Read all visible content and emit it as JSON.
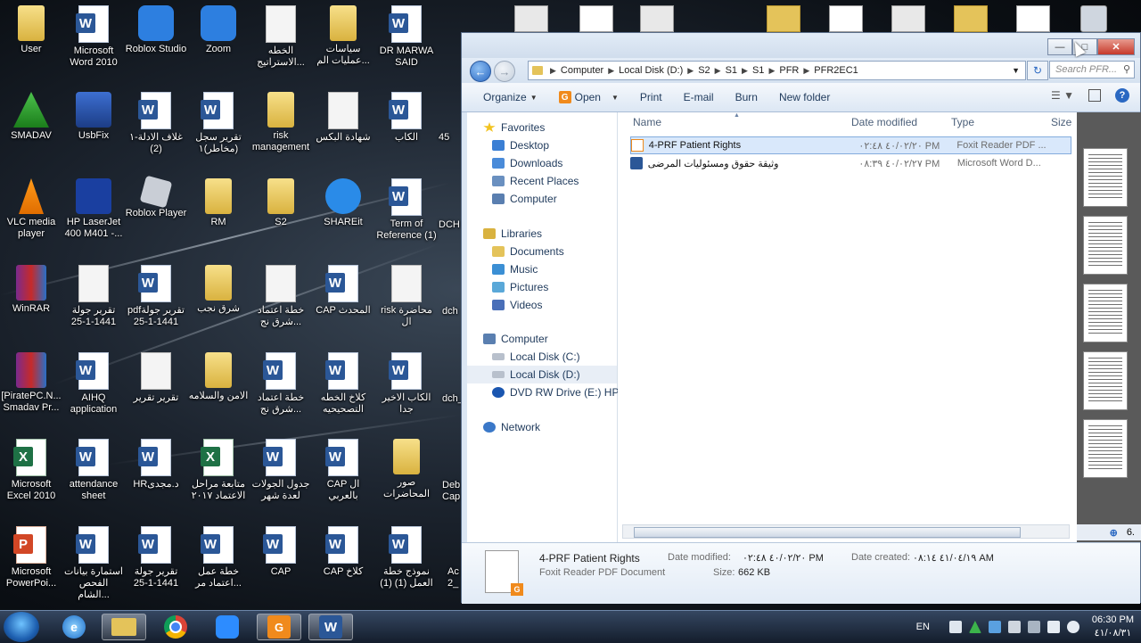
{
  "desktop": {
    "icons": [
      {
        "label": "User",
        "kind": "folder"
      },
      {
        "label": "Microsoft Word 2010",
        "kind": "word"
      },
      {
        "label": "Roblox Studio",
        "kind": "blue"
      },
      {
        "label": "Zoom",
        "kind": "blue"
      },
      {
        "label": "الخطه الاستراتيج...",
        "kind": "doc"
      },
      {
        "label": "سياسات عمليات الم...",
        "kind": "folder"
      },
      {
        "label": "DR MARWA SAID",
        "kind": "word"
      },
      {
        "label": "SMADAV",
        "kind": "green"
      },
      {
        "label": "UsbFix",
        "kind": "usb"
      },
      {
        "label": "غلاف الادلة-١ (2)",
        "kind": "word"
      },
      {
        "label": "تقرير سجل (مخاطر)١",
        "kind": "word"
      },
      {
        "label": "risk management",
        "kind": "folder"
      },
      {
        "label": "شهادة البكس",
        "kind": "doc"
      },
      {
        "label": "الكاب",
        "kind": "word"
      },
      {
        "label": "VLC media player",
        "kind": "cone"
      },
      {
        "label": "HP LaserJet 400 M401 -...",
        "kind": "hp"
      },
      {
        "label": "Roblox Player",
        "kind": "gray"
      },
      {
        "label": "RM",
        "kind": "folder"
      },
      {
        "label": "S2",
        "kind": "folder"
      },
      {
        "label": "SHAREit",
        "kind": "share"
      },
      {
        "label": "Term of Reference (1)",
        "kind": "word"
      },
      {
        "label": "WinRAR",
        "kind": "rar"
      },
      {
        "label": "تقرير جولة 1441-1-25",
        "kind": "doc"
      },
      {
        "label": "pdfتقرير جولة 1441-1-25",
        "kind": "word"
      },
      {
        "label": "شرق نجب",
        "kind": "folder"
      },
      {
        "label": "خطة اعتماد شرق نج...",
        "kind": "doc"
      },
      {
        "label": "CAP المحدث",
        "kind": "word"
      },
      {
        "label": "risk محاضرة ال",
        "kind": "doc"
      },
      {
        "label": "[PiratePC.N... Smadav Pr...",
        "kind": "rar"
      },
      {
        "label": "AIHQ application",
        "kind": "word"
      },
      {
        "label": "تقرير تقرير",
        "kind": "doc"
      },
      {
        "label": "الامن والسلامه",
        "kind": "folder"
      },
      {
        "label": "خطة اعتماد شرق نج...",
        "kind": "word"
      },
      {
        "label": "كلاخ الخطه التصحيحيه",
        "kind": "word"
      },
      {
        "label": "الكاب الاخير جدا",
        "kind": "word"
      },
      {
        "label": "Microsoft Excel 2010",
        "kind": "excel"
      },
      {
        "label": "attendance sheet",
        "kind": "word"
      },
      {
        "label": "HRد.مجدى",
        "kind": "word"
      },
      {
        "label": "متابعة مراحل الاعتماد ٢٠١٧",
        "kind": "excel"
      },
      {
        "label": "جدول الجولات لعدة شهر",
        "kind": "word"
      },
      {
        "label": "CAP ال بالعربي",
        "kind": "word"
      },
      {
        "label": "صور المحاضرات",
        "kind": "folder"
      },
      {
        "label": "Microsoft PowerPoi...",
        "kind": "ppt"
      },
      {
        "label": "استمارة بيانات الفحص الشام...",
        "kind": "word"
      },
      {
        "label": "تقرير جولة 1441-1-25",
        "kind": "word"
      },
      {
        "label": "خطة عمل اعتماد مر...",
        "kind": "word"
      },
      {
        "label": "CAP",
        "kind": "word"
      },
      {
        "label": "CAP كلاخ",
        "kind": "word"
      },
      {
        "label": "نموذج خطة العمل (1) (1)",
        "kind": "word"
      }
    ],
    "partial_labels": [
      "45",
      "DCH",
      "dch",
      "dch_",
      "Deb Cap",
      "Ac 2_"
    ]
  },
  "explorer": {
    "nav": {
      "address": [
        "Computer",
        "Local Disk (D:)",
        "S2",
        "S1",
        "S1",
        "PFR",
        "PFR2EC1"
      ],
      "search_placeholder": "Search PFR..."
    },
    "toolbar": {
      "organize": "Organize",
      "open": "Open",
      "print": "Print",
      "email": "E-mail",
      "burn": "Burn",
      "new_folder": "New folder"
    },
    "sidebar": {
      "favorites": "Favorites",
      "desktop": "Desktop",
      "downloads": "Downloads",
      "recent": "Recent Places",
      "computer_fav": "Computer",
      "libraries": "Libraries",
      "documents": "Documents",
      "music": "Music",
      "pictures": "Pictures",
      "videos": "Videos",
      "computer": "Computer",
      "disk_c": "Local Disk (C:)",
      "disk_d": "Local Disk (D:)",
      "dvd": "DVD RW Drive (E:) HP LJ",
      "network": "Network"
    },
    "columns": {
      "name": "Name",
      "date": "Date modified",
      "type": "Type",
      "size": "Size"
    },
    "files": [
      {
        "name": "4-PRF  Patient Rights",
        "date": "٤٠/٠٢/٢٠ ٠٢:٤٨ PM",
        "type": "Foxit Reader PDF ..."
      },
      {
        "name": "وثيقة حقوق ومسئوليات المرضى",
        "date": "٤٠/٠٢/٢٧ ٠٨:٣٩ PM",
        "type": "Microsoft Word D..."
      }
    ],
    "details": {
      "name": "4-PRF  Patient Rights",
      "type": "Foxit Reader PDF Document",
      "modified_label": "Date modified:",
      "modified": "٤٠/٠٢/٢٠ ٠٢:٤٨ PM",
      "size_label": "Size:",
      "size": "662 KB",
      "created_label": "Date created:",
      "created": "٤١/٠٤/١٩ ٠٨:١٤ AM"
    },
    "preview_edge_text": "6."
  },
  "taskbar": {
    "lang": "EN",
    "time": "06:30 PM",
    "date": "٤١/٠٨/٣١"
  }
}
